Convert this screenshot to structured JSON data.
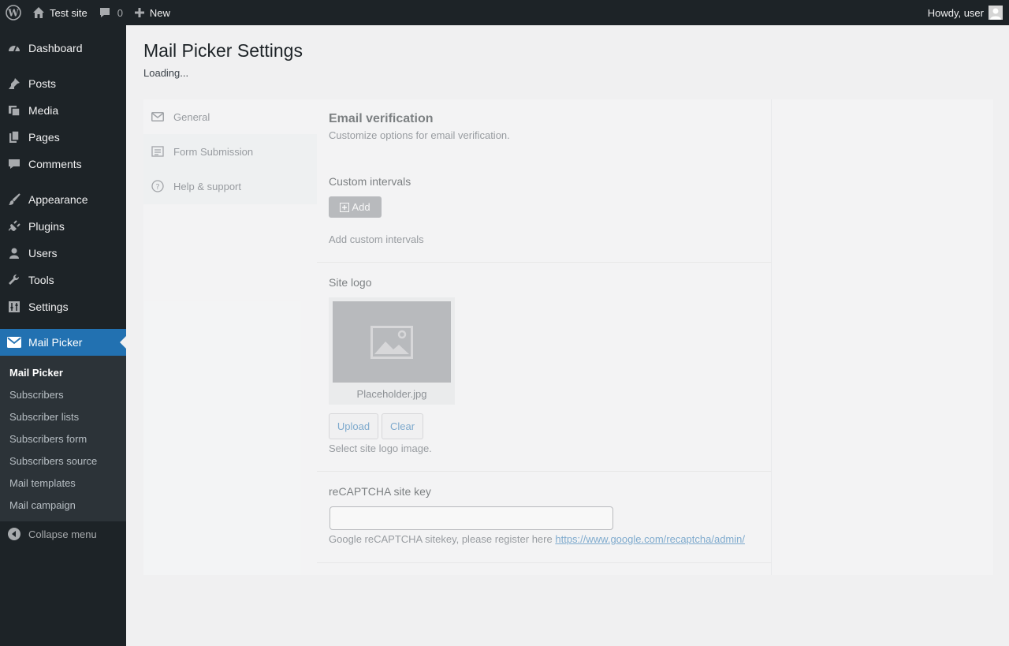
{
  "adminbar": {
    "site_name": "Test site",
    "comments_count": "0",
    "new_label": "New",
    "greeting": "Howdy, user"
  },
  "sidebar": {
    "items": [
      {
        "label": "Dashboard",
        "icon": "dashboard-icon"
      },
      {
        "label": "Posts",
        "icon": "pin-icon"
      },
      {
        "label": "Media",
        "icon": "media-icon"
      },
      {
        "label": "Pages",
        "icon": "pages-icon"
      },
      {
        "label": "Comments",
        "icon": "comment-icon"
      },
      {
        "label": "Appearance",
        "icon": "brush-icon"
      },
      {
        "label": "Plugins",
        "icon": "plug-icon"
      },
      {
        "label": "Users",
        "icon": "user-icon"
      },
      {
        "label": "Tools",
        "icon": "wrench-icon"
      },
      {
        "label": "Settings",
        "icon": "sliders-icon"
      },
      {
        "label": "Mail Picker",
        "icon": "envelope-icon"
      }
    ],
    "submenu": [
      "Mail Picker",
      "Subscribers",
      "Subscriber lists",
      "Subscribers form",
      "Subscribers source",
      "Mail templates",
      "Mail campaign"
    ],
    "collapse_label": "Collapse menu"
  },
  "page": {
    "title": "Mail Picker Settings",
    "loading": "Loading..."
  },
  "tabs": [
    {
      "label": "General",
      "icon": "envelope-icon"
    },
    {
      "label": "Form Submission",
      "icon": "form-icon"
    },
    {
      "label": "Help & support",
      "icon": "question-icon"
    }
  ],
  "settings": {
    "email_verification": {
      "title": "Email verification",
      "description": "Customize options for email verification."
    },
    "custom_intervals": {
      "label": "Custom intervals",
      "add_button": "Add",
      "description": "Add custom intervals"
    },
    "site_logo": {
      "label": "Site logo",
      "filename": "Placeholder.jpg",
      "upload_button": "Upload",
      "clear_button": "Clear",
      "description": "Select site logo image."
    },
    "recaptcha": {
      "label": "reCAPTCHA site key",
      "value": "",
      "description": "Google reCAPTCHA sitekey, please register here",
      "link": "https://www.google.com/recaptcha/admin/"
    }
  },
  "colors": {
    "admin_bg": "#1d2327",
    "accent": "#2271b1",
    "page_bg": "#f0f0f1"
  }
}
